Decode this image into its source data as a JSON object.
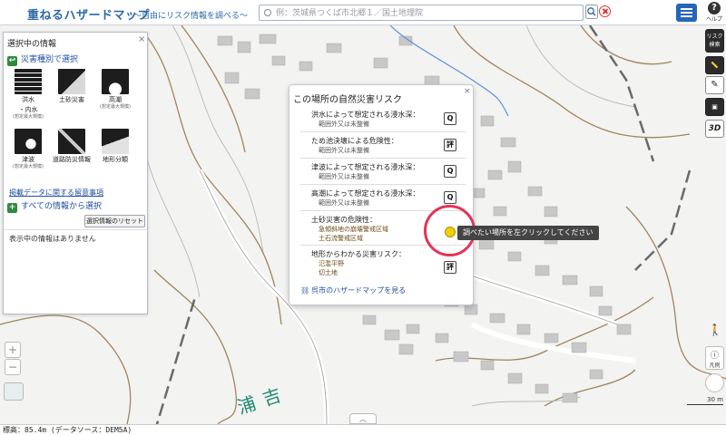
{
  "header": {
    "logo": "重ねるハザードマップ",
    "subtitle": "〜自由にリスク情報を調べる〜",
    "search_placeholder": "例：茨城県つくば市北郷１／国土地理院",
    "help_label": "ヘルプ"
  },
  "left_panel": {
    "title": "選択中の情報",
    "section_by_type": "災害種別で選択",
    "categories": [
      {
        "label": "洪水",
        "label2": "・内水",
        "sub": "(想定最大規模)"
      },
      {
        "label": "土砂災害",
        "label2": "",
        "sub": ""
      },
      {
        "label": "高潮",
        "label2": "",
        "sub": "(想定最大規模)"
      },
      {
        "label": "津波",
        "label2": "",
        "sub": "(想定最大規模)"
      },
      {
        "label": "道路防災情報",
        "label2": "",
        "sub": ""
      },
      {
        "label": "地形分類",
        "label2": "",
        "sub": ""
      }
    ],
    "notes_link": "掲載データに関する留意事項",
    "section_all": "すべての情報から選択",
    "reset_button": "選択情報のリセット",
    "status": "表示中の情報はありません"
  },
  "popup": {
    "title": "この場所の自然災害リスク",
    "rows": [
      {
        "heading": "洪水によって想定される浸水深：",
        "values": [
          "範囲外又は未整備"
        ],
        "icon": "Q"
      },
      {
        "heading": "ため池決壊による危険性：",
        "values": [
          "範囲外又は未整備"
        ],
        "icon": "評"
      },
      {
        "heading": "津波によって想定される浸水深：",
        "values": [
          "範囲外又は未整備"
        ],
        "icon": "Q"
      },
      {
        "heading": "高潮によって想定される浸水深：",
        "values": [
          "範囲外又は未整備"
        ],
        "icon": "Q"
      },
      {
        "heading": "土砂災害の危険性：",
        "values": [
          "急傾斜地の崩壊警戒区域",
          "土石流警戒区域"
        ],
        "icon": "Q"
      },
      {
        "heading": "地形からわかる災害リスク：",
        "values": [
          "氾濫平野",
          "切土地"
        ],
        "icon": "評"
      }
    ],
    "city_link": "呉市のハザードマップを見る"
  },
  "tooltip": "調べたい場所を左クリックしてください",
  "tools": {
    "risk_search": "リスク検索",
    "ruler": "ruler-icon",
    "pencil": "pencil-icon",
    "case": "briefcase-icon",
    "three_d": "3D",
    "legend": "凡例"
  },
  "zoom": {
    "in": "+",
    "out": "−"
  },
  "scale": "30 m",
  "map_label": "吉浦",
  "footer": {
    "elevation": "標高：85.4m (データソース：DEM5A)"
  },
  "colors": {
    "brand": "#2c6aa7",
    "menu": "#2765b8",
    "section_green": "#2e8b3e",
    "highlight": "#e53355",
    "contour": "#8a6a38"
  }
}
